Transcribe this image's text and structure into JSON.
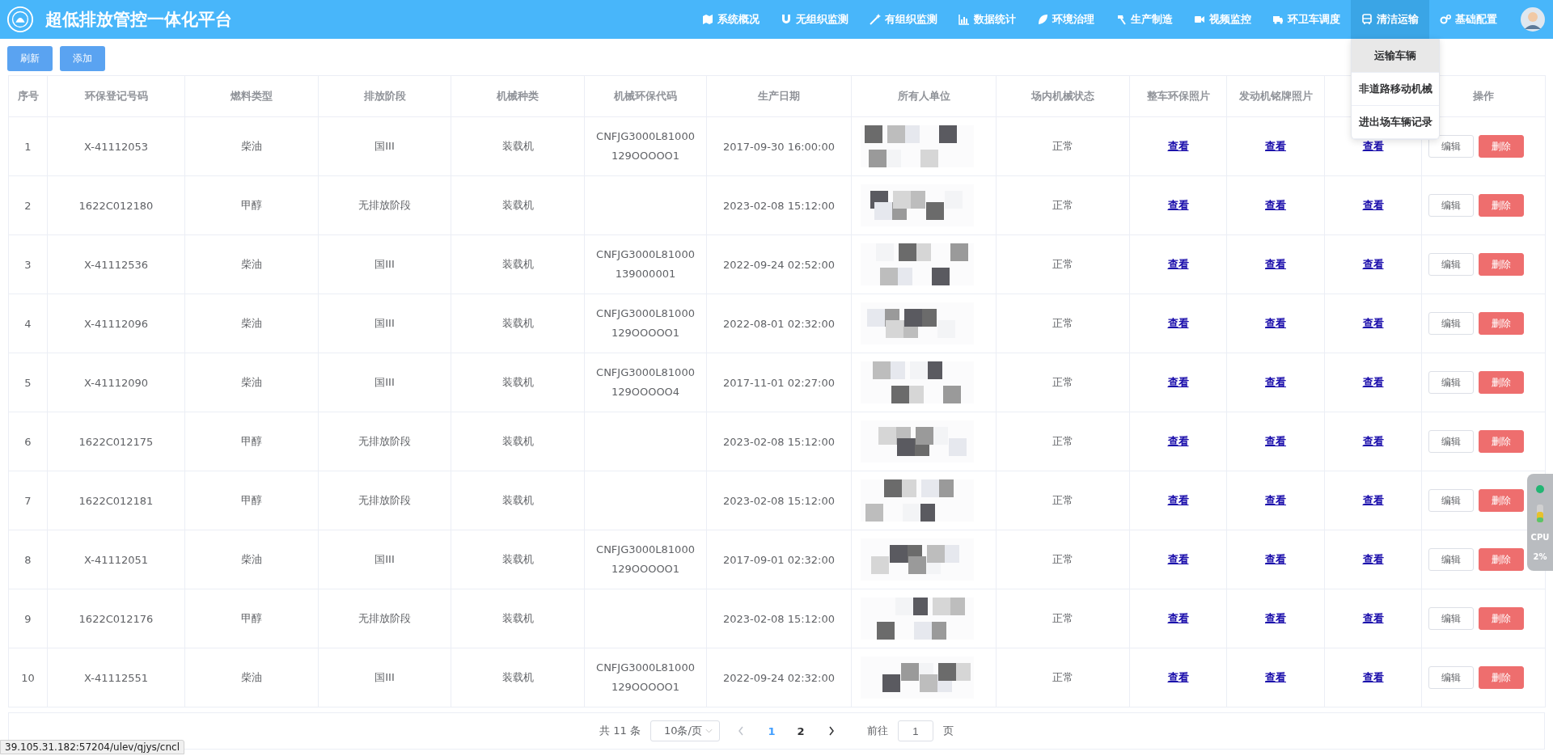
{
  "header": {
    "title": "超低排放管控一体化平台",
    "nav": [
      {
        "label": "系统概况",
        "selected": false
      },
      {
        "label": "无组织监测",
        "selected": false
      },
      {
        "label": "有组织监测",
        "selected": false
      },
      {
        "label": "数据统计",
        "selected": false
      },
      {
        "label": "环境治理",
        "selected": false
      },
      {
        "label": "生产制造",
        "selected": false
      },
      {
        "label": "视频监控",
        "selected": false
      },
      {
        "label": "环卫车调度",
        "selected": false
      },
      {
        "label": "清洁运输",
        "selected": true
      },
      {
        "label": "基础配置",
        "selected": false
      }
    ],
    "dropdown": [
      {
        "label": "运输车辆",
        "selected": true
      },
      {
        "label": "非道路移动机械",
        "selected": false
      },
      {
        "label": "进出场车辆记录",
        "selected": false
      }
    ]
  },
  "toolbar": [
    "刷新",
    "添加"
  ],
  "table": {
    "columns": [
      {
        "label": "序号"
      },
      {
        "label": "环保登记号码"
      },
      {
        "label": "燃料类型"
      },
      {
        "label": "排放阶段"
      },
      {
        "label": "机械种类"
      },
      {
        "label": "机械环保代码"
      },
      {
        "label": "生产日期"
      },
      {
        "label": "所有人单位"
      },
      {
        "label": "场内机械状态"
      },
      {
        "label": "整车环保照片"
      },
      {
        "label": "发动机铭牌照片"
      },
      {
        "label": "操作"
      }
    ],
    "rows": [
      {
        "no": "1",
        "reg": "X-41112053",
        "fuel": "柴油",
        "stage": "国III",
        "type": "装载机",
        "code": [
          "CNFJG3000L81000",
          "129OOOOO1"
        ],
        "date": "2017-09-30 16:00:00",
        "status": "正常",
        "links": [
          "查看",
          "查看",
          "查看"
        ],
        "actions": [
          "编辑",
          "删除"
        ]
      },
      {
        "no": "2",
        "reg": "1622C012180",
        "fuel": "甲醇",
        "stage": "无排放阶段",
        "type": "装载机",
        "date": "2023-02-08 15:12:00",
        "status": "正常",
        "links": [
          "查看",
          "查看",
          "查看"
        ],
        "actions": [
          "编辑",
          "删除"
        ]
      },
      {
        "no": "3",
        "reg": "X-41112536",
        "fuel": "柴油",
        "stage": "国III",
        "type": "装载机",
        "code": [
          "CNFJG3000L81000",
          "139000001"
        ],
        "date": "2022-09-24 02:52:00",
        "status": "正常",
        "links": [
          "查看",
          "查看",
          "查看"
        ],
        "actions": [
          "编辑",
          "删除"
        ]
      },
      {
        "no": "4",
        "reg": "X-41112096",
        "fuel": "柴油",
        "stage": "国III",
        "type": "装载机",
        "code": [
          "CNFJG3000L81000",
          "129OOOOO1"
        ],
        "date": "2022-08-01 02:32:00",
        "status": "正常",
        "links": [
          "查看",
          "查看",
          "查看"
        ],
        "actions": [
          "编辑",
          "删除"
        ]
      },
      {
        "no": "5",
        "reg": "X-41112090",
        "fuel": "柴油",
        "stage": "国III",
        "type": "装载机",
        "code": [
          "CNFJG3000L81000",
          "129OOOOO4"
        ],
        "date": "2017-11-01 02:27:00",
        "status": "正常",
        "links": [
          "查看",
          "查看",
          "查看"
        ],
        "actions": [
          "编辑",
          "删除"
        ]
      },
      {
        "no": "6",
        "reg": "1622C012175",
        "fuel": "甲醇",
        "stage": "无排放阶段",
        "type": "装载机",
        "date": "2023-02-08 15:12:00",
        "status": "正常",
        "links": [
          "查看",
          "查看",
          "查看"
        ],
        "actions": [
          "编辑",
          "删除"
        ]
      },
      {
        "no": "7",
        "reg": "1622C012181",
        "fuel": "甲醇",
        "stage": "无排放阶段",
        "type": "装载机",
        "date": "2023-02-08 15:12:00",
        "status": "正常",
        "links": [
          "查看",
          "查看",
          "查看"
        ],
        "actions": [
          "编辑",
          "删除"
        ]
      },
      {
        "no": "8",
        "reg": "X-41112051",
        "fuel": "柴油",
        "stage": "国III",
        "type": "装载机",
        "code": [
          "CNFJG3000L81000",
          "129OOOOO1"
        ],
        "date": "2017-09-01 02:32:00",
        "status": "正常",
        "links": [
          "查看",
          "查看",
          "查看"
        ],
        "actions": [
          "编辑",
          "删除"
        ]
      },
      {
        "no": "9",
        "reg": "1622C012176",
        "fuel": "甲醇",
        "stage": "无排放阶段",
        "type": "装载机",
        "date": "2023-02-08 15:12:00",
        "status": "正常",
        "links": [
          "查看",
          "查看",
          "查看"
        ],
        "actions": [
          "编辑",
          "删除"
        ]
      },
      {
        "no": "10",
        "reg": "X-41112551",
        "fuel": "柴油",
        "stage": "国III",
        "type": "装载机",
        "code": [
          "CNFJG3000L81000",
          "129OOOOO1"
        ],
        "date": "2022-09-24 02:32:00",
        "status": "正常",
        "links": [
          "查看",
          "查看",
          "查看"
        ],
        "actions": [
          "编辑",
          "删除"
        ]
      }
    ]
  },
  "pagination": {
    "total": "共 11 条",
    "page_size": "10条/页",
    "pages": [
      {
        "label": "1",
        "selected": true
      },
      {
        "label": "2",
        "selected": false
      }
    ],
    "goto_label": "前往",
    "goto_value": "1",
    "goto_unit": "页"
  },
  "status_url": "39.105.31.182:57204/ulev/qjys/cncl",
  "cpu_widget": {
    "label": "CPU",
    "reading": "2%"
  }
}
